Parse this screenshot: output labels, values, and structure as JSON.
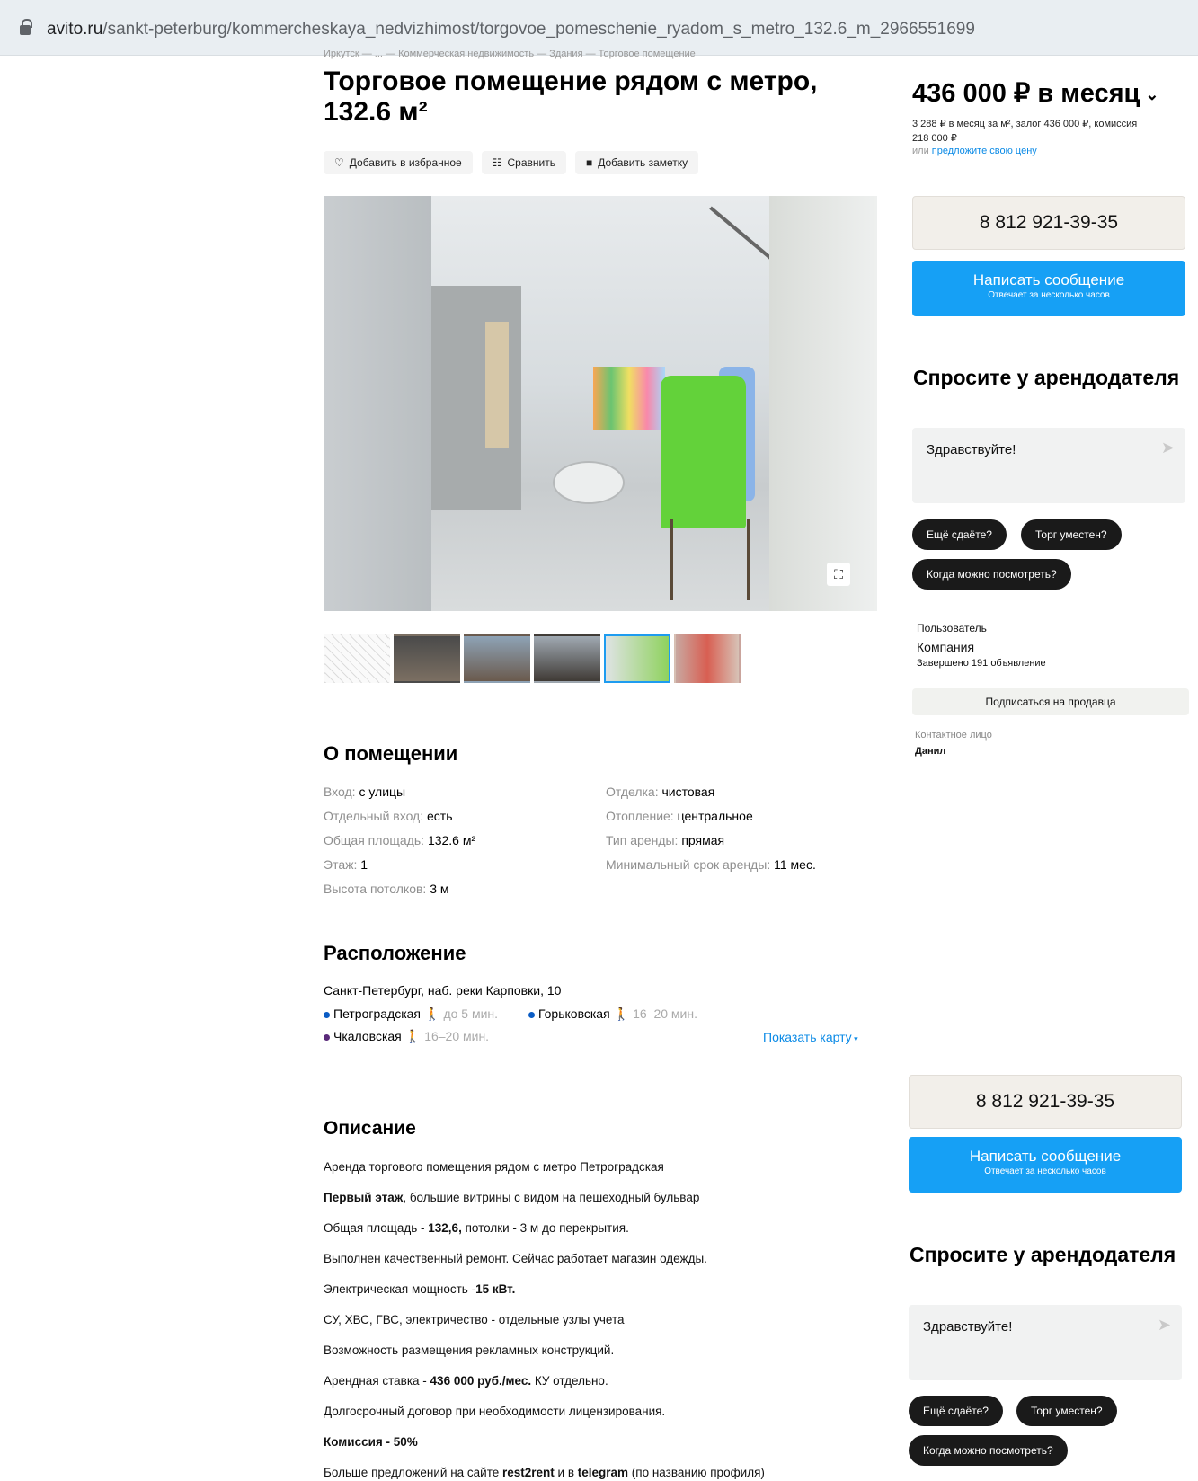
{
  "browser": {
    "url_domain": "avito.ru",
    "url_path": "/sankt-peterburg/kommercheskaya_nedvizhimost/torgovoe_pomeschenie_ryadom_s_metro_132.6_m_2966551699"
  },
  "breadcrumb": "Иркутск — ... — Коммерческая недвижимость — Здания — Торговое помещение",
  "title": "Торговое помещение рядом с метро, 132.6 м²",
  "actions": {
    "favorite": "Добавить в избранное",
    "compare": "Сравнить",
    "note": "Добавить заметку"
  },
  "about": {
    "heading": "О помещении",
    "left": [
      {
        "key": "Вход: ",
        "value": "с улицы"
      },
      {
        "key": "Отдельный вход: ",
        "value": "есть"
      },
      {
        "key": "Общая площадь: ",
        "value": "132.6 м²"
      },
      {
        "key": "Этаж: ",
        "value": "1"
      },
      {
        "key": "Высота потолков: ",
        "value": "3 м"
      }
    ],
    "right": [
      {
        "key": "Отделка: ",
        "value": "чистовая"
      },
      {
        "key": "Отопление: ",
        "value": "центральное"
      },
      {
        "key": "Тип аренды: ",
        "value": "прямая"
      },
      {
        "key": "Минимальный срок аренды: ",
        "value": "11 мес."
      }
    ]
  },
  "location": {
    "heading": "Расположение",
    "address": "Санкт-Петербург, наб. реки Карповки, 10",
    "metro": [
      {
        "name": "Петроградская",
        "walk": "до 5 мин.",
        "color": "#0a5cc4"
      },
      {
        "name": "Горьковская",
        "walk": "16–20 мин.",
        "color": "#0a5cc4"
      },
      {
        "name": "Чкаловская",
        "walk": "16–20 мин.",
        "color": "#5a2a7a"
      }
    ],
    "show_map": "Показать карту"
  },
  "description": {
    "heading": "Описание",
    "lines": [
      [
        "",
        "Аренда торгового помещения рядом с метро Петроградская",
        ""
      ],
      [
        "Первый этаж",
        ", большие витрины с видом на пешеходный бульвар",
        ""
      ],
      [
        "",
        "Общая площадь - ",
        "132,6,"
      ],
      [
        "",
        "Выполнен качественный ремонт. Сейчас работает магазин одежды.",
        ""
      ],
      [
        "",
        "Электрическая мощность -",
        "15 кВт."
      ],
      [
        "",
        "СУ, ХВС, ГВС, электричество - отдельные узлы учета",
        ""
      ],
      [
        "",
        "Возможность размещения рекламных конструкций.",
        ""
      ],
      [
        "",
        "Арендная ставка - ",
        "436 000 руб./мес."
      ],
      [
        "",
        "Долгосрочный договор при необходимости лицензирования.",
        ""
      ],
      [
        "Комиссия - 50%",
        "",
        ""
      ]
    ],
    "line3_tail": " потолки - 3 м до перекрытия.",
    "line8_tail": " КУ отдельно.",
    "last_line": {
      "a": "Больше предложений на сайте ",
      "b": "rest2rent",
      "c": " и в ",
      "d": "telegram",
      "e": " (по названию профиля)"
    }
  },
  "sidebar": {
    "price": "436 000 ₽ в месяц",
    "price_sub": "3 288 ₽ в месяц за м², залог 436 000 ₽, комиссия 218 000 ₽",
    "offer_prefix": "или ",
    "offer_link": "предложите свою цену",
    "phone": "8 812 921-39-35",
    "message_title": "Написать сообщение",
    "message_sub": "Отвечает за несколько часов",
    "ask_title": "Спросите у арендодателя",
    "ask_placeholder": "Здравствуйте!",
    "chips": [
      "Ещё сдаёте?",
      "Торг уместен?",
      "Когда можно посмотреть?"
    ],
    "seller_label": "Пользователь",
    "seller_name": "Компания",
    "seller_done": "Завершено 191 объявление",
    "subscribe": "Подписаться на продавца",
    "contact_label": "Контактное лицо",
    "contact_name": "Данил"
  },
  "colors": {
    "accent": "#16a0f5",
    "link": "#0a8ae6",
    "phone_bg": "#f2efea"
  }
}
